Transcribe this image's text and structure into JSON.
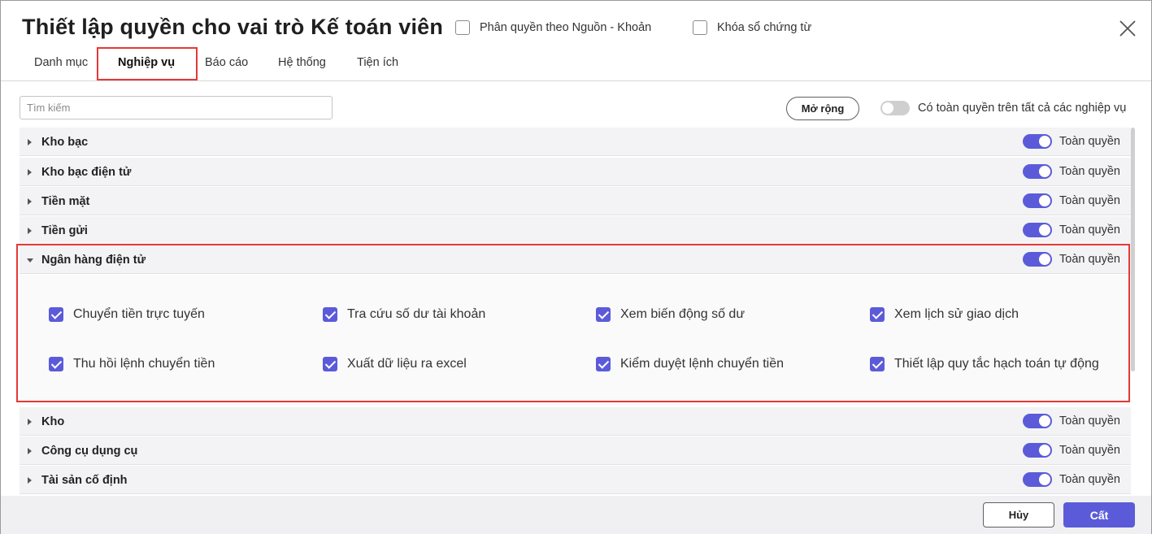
{
  "dialog": {
    "title": "Thiết lập quyền cho vai trò Kế toán viên",
    "options": {
      "source_permission_label": "Phân quyền theo Nguồn - Khoản",
      "lock_voucher_label": "Khóa sổ chứng từ"
    }
  },
  "tabs": [
    {
      "label": "Danh mục"
    },
    {
      "label": "Nghiệp vụ",
      "active": true
    },
    {
      "label": "Báo cáo"
    },
    {
      "label": "Hệ thống"
    },
    {
      "label": "Tiện ích"
    }
  ],
  "toolbar": {
    "search_placeholder": "Tìm kiếm",
    "expand_label": "Mở rộng",
    "all_permission_label": "Có toàn quyền trên tất cả các nghiệp vụ"
  },
  "full_permission_label": "Toàn quyền",
  "categories": [
    {
      "name": "Kho bạc",
      "full_permission": true
    },
    {
      "name": "Kho bạc điện tử",
      "full_permission": true
    },
    {
      "name": "Tiền mặt",
      "full_permission": true
    },
    {
      "name": "Tiền gửi",
      "full_permission": true
    },
    {
      "name": "Ngân hàng điện tử",
      "full_permission": true,
      "expanded": true
    },
    {
      "name": "Kho",
      "full_permission": true
    },
    {
      "name": "Công cụ dụng cụ",
      "full_permission": true
    },
    {
      "name": "Tài sản cố định",
      "full_permission": true
    }
  ],
  "expanded_permissions": [
    "Chuyển tiền trực tuyến",
    "Tra cứu số dư tài khoản",
    "Xem biến động số dư",
    "Xem lịch sử giao dịch",
    "Thu hồi lệnh chuyển tiền",
    "Xuất dữ liệu ra excel",
    "Kiểm duyệt lệnh chuyển tiền",
    "Thiết lập quy tắc hạch toán tự động"
  ],
  "footer": {
    "cancel_label": "Hủy",
    "save_label": "Cất"
  },
  "colors": {
    "accent": "#5b5bd9",
    "highlight": "#e53935"
  }
}
